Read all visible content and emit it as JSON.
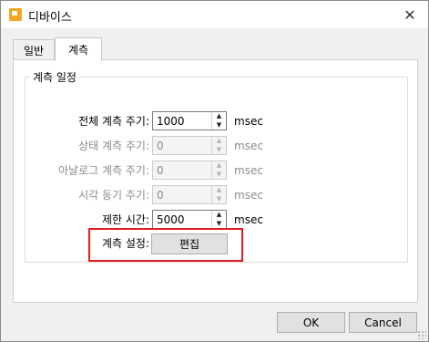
{
  "window": {
    "title": "디바이스",
    "app_icon": "device-app-icon"
  },
  "tabs": [
    {
      "label": "일반"
    },
    {
      "label": "계측"
    }
  ],
  "group": {
    "legend": "계측 일정",
    "rows": [
      {
        "label": "전체 계측 주기:",
        "value": "1000",
        "unit": "msec",
        "enabled": true
      },
      {
        "label": "상태 계측 주기:",
        "value": "0",
        "unit": "msec",
        "enabled": false
      },
      {
        "label": "아날로그 계측 주기:",
        "value": "0",
        "unit": "msec",
        "enabled": false
      },
      {
        "label": "시각 동기 주기:",
        "value": "0",
        "unit": "msec",
        "enabled": false
      },
      {
        "label": "제한 시간:",
        "value": "5000",
        "unit": "msec",
        "enabled": true
      }
    ],
    "measure_settings": {
      "label": "계측 설정:",
      "button": "편집"
    }
  },
  "footer": {
    "ok": "OK",
    "cancel": "Cancel"
  },
  "colors": {
    "highlight": "#e11c1c",
    "window_bg": "#f0f0f0",
    "panel_bg": "#ffffff"
  }
}
